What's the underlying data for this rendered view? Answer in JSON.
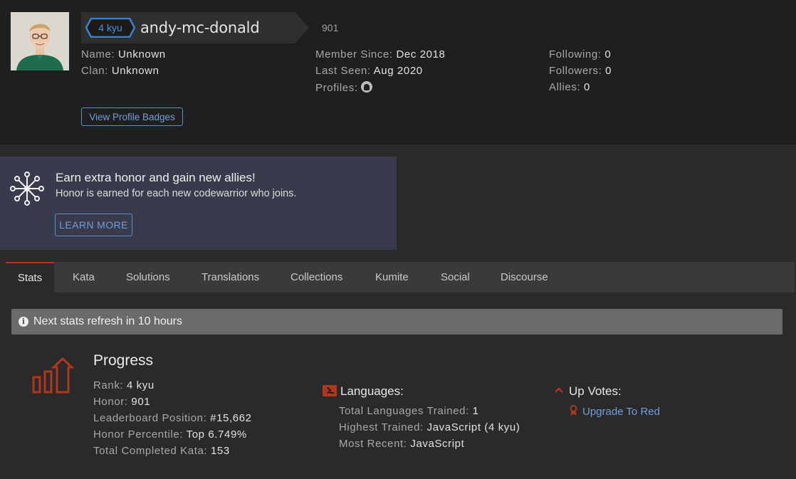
{
  "profile": {
    "rank": "4 kyu",
    "username": "andy-mc-donald",
    "honor": "901",
    "fields": [
      {
        "label": "Name:",
        "value": "Unknown"
      },
      {
        "label": "Clan:",
        "value": "Unknown"
      },
      {
        "label": "Member Since:",
        "value": "Dec 2018"
      },
      {
        "label": "Last Seen:",
        "value": "Aug 2020"
      },
      {
        "label": "Profiles:",
        "value": ""
      },
      {
        "label": "Following:",
        "value": "0"
      },
      {
        "label": "Followers:",
        "value": "0"
      },
      {
        "label": "Allies:",
        "value": "0"
      }
    ],
    "profile_icon": "github-icon",
    "badges_button": "View Profile Badges"
  },
  "invite": {
    "title": "Earn extra honor and gain new allies!",
    "subtitle": "Honor is earned for each new codewarrior who joins.",
    "button": "LEARN MORE"
  },
  "tabs": [
    "Stats",
    "Kata",
    "Solutions",
    "Translations",
    "Collections",
    "Kumite",
    "Social",
    "Discourse"
  ],
  "active_tab": "Stats",
  "notice": "Next stats refresh in 10 hours",
  "progress": {
    "title": "Progress",
    "rows": [
      {
        "label": "Rank:",
        "value": "4 kyu"
      },
      {
        "label": "Honor:",
        "value": "901"
      },
      {
        "label": "Leaderboard Position:",
        "value": "#15,662"
      },
      {
        "label": "Honor Percentile:",
        "value": "Top 6.749%"
      },
      {
        "label": "Total Completed Kata:",
        "value": "153"
      }
    ]
  },
  "languages": {
    "title": "Languages:",
    "rows": [
      {
        "label": "Total Languages Trained:",
        "value": "1"
      },
      {
        "label": "Highest Trained:",
        "value": "JavaScript (4 kyu)"
      },
      {
        "label": "Most Recent:",
        "value": "JavaScript"
      }
    ]
  },
  "upvotes": {
    "title": "Up Votes:",
    "link": "Upgrade To Red"
  },
  "colors": {
    "accent_red": "#b1361e",
    "link_blue": "#6f9fdc",
    "rank_blue": "#4a8fd0"
  }
}
